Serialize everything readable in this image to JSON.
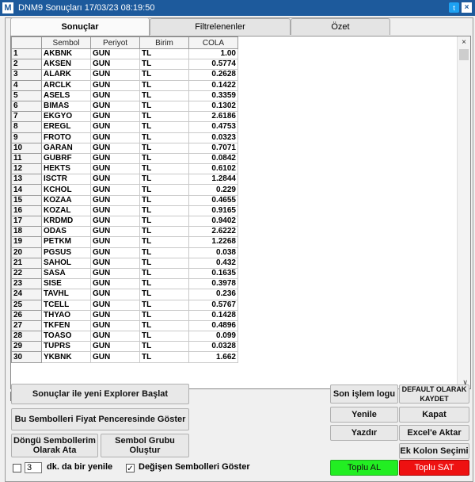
{
  "window": {
    "logo": "M",
    "title": "DNM9 Sonuçları  17/03/23 08:19:50"
  },
  "tabs": [
    {
      "label": "Sonuçlar",
      "active": true
    },
    {
      "label": "Filtrelenenler",
      "active": false
    },
    {
      "label": "Özet",
      "active": false
    }
  ],
  "table": {
    "columns": [
      "",
      "Sembol",
      "Periyot",
      "Birim",
      "COLA"
    ],
    "rows": [
      [
        "1",
        "AKBNK",
        "GUN",
        "TL",
        "1.00"
      ],
      [
        "2",
        "AKSEN",
        "GUN",
        "TL",
        "0.5774"
      ],
      [
        "3",
        "ALARK",
        "GUN",
        "TL",
        "0.2628"
      ],
      [
        "4",
        "ARCLK",
        "GUN",
        "TL",
        "0.1422"
      ],
      [
        "5",
        "ASELS",
        "GUN",
        "TL",
        "0.3359"
      ],
      [
        "6",
        "BIMAS",
        "GUN",
        "TL",
        "0.1302"
      ],
      [
        "7",
        "EKGYO",
        "GUN",
        "TL",
        "2.6186"
      ],
      [
        "8",
        "EREGL",
        "GUN",
        "TL",
        "0.4753"
      ],
      [
        "9",
        "FROTO",
        "GUN",
        "TL",
        "0.0323"
      ],
      [
        "10",
        "GARAN",
        "GUN",
        "TL",
        "0.7071"
      ],
      [
        "11",
        "GUBRF",
        "GUN",
        "TL",
        "0.0842"
      ],
      [
        "12",
        "HEKTS",
        "GUN",
        "TL",
        "0.6102"
      ],
      [
        "13",
        "ISCTR",
        "GUN",
        "TL",
        "1.2844"
      ],
      [
        "14",
        "KCHOL",
        "GUN",
        "TL",
        "0.229"
      ],
      [
        "15",
        "KOZAA",
        "GUN",
        "TL",
        "0.4655"
      ],
      [
        "16",
        "KOZAL",
        "GUN",
        "TL",
        "0.9165"
      ],
      [
        "17",
        "KRDMD",
        "GUN",
        "TL",
        "0.9402"
      ],
      [
        "18",
        "ODAS",
        "GUN",
        "TL",
        "2.6222"
      ],
      [
        "19",
        "PETKM",
        "GUN",
        "TL",
        "1.2268"
      ],
      [
        "20",
        "PGSUS",
        "GUN",
        "TL",
        "0.038"
      ],
      [
        "21",
        "SAHOL",
        "GUN",
        "TL",
        "0.432"
      ],
      [
        "22",
        "SASA",
        "GUN",
        "TL",
        "0.1635"
      ],
      [
        "23",
        "SISE",
        "GUN",
        "TL",
        "0.3978"
      ],
      [
        "24",
        "TAVHL",
        "GUN",
        "TL",
        "0.236"
      ],
      [
        "25",
        "TCELL",
        "GUN",
        "TL",
        "0.5767"
      ],
      [
        "26",
        "THYAO",
        "GUN",
        "TL",
        "0.1428"
      ],
      [
        "27",
        "TKFEN",
        "GUN",
        "TL",
        "0.4896"
      ],
      [
        "28",
        "TOASO",
        "GUN",
        "TL",
        "0.099"
      ],
      [
        "29",
        "TUPRS",
        "GUN",
        "TL",
        "0.0328"
      ],
      [
        "30",
        "YKBNK",
        "GUN",
        "TL",
        "1.662"
      ]
    ]
  },
  "buttons": {
    "explorer": "Sonuçlar ile yeni Explorer Başlat",
    "price_window": "Bu Sembolleri Fiyat Penceresinde Göster",
    "loop_symbols": "Döngü Sembollerim Olarak Ata",
    "symbol_group": "Sembol Grubu Oluştur",
    "last_log": "Son işlem logu",
    "default_save": "DEFAULT OLARAK KAYDET",
    "refresh": "Yenile",
    "close": "Kapat",
    "print": "Yazdır",
    "excel": "Excel'e Aktar",
    "columns": "Ek Kolon Seçimi",
    "buy_all": "Toplu AL",
    "sell_all": "Toplu SAT"
  },
  "refresh": {
    "minutes": "3",
    "label": "dk. da bir yenile",
    "checked": false
  },
  "show_changing": {
    "label": "Değişen Sembolleri Göster",
    "checked": true
  },
  "icons": {
    "twitter": "twitter-icon",
    "close": "close-icon",
    "scroll_close": "x-icon",
    "scroll_down": "chevron-down-icon"
  },
  "colors": {
    "titlebar": "#1d5a9c",
    "buy": "#22ee22",
    "sell": "#ee1111"
  }
}
